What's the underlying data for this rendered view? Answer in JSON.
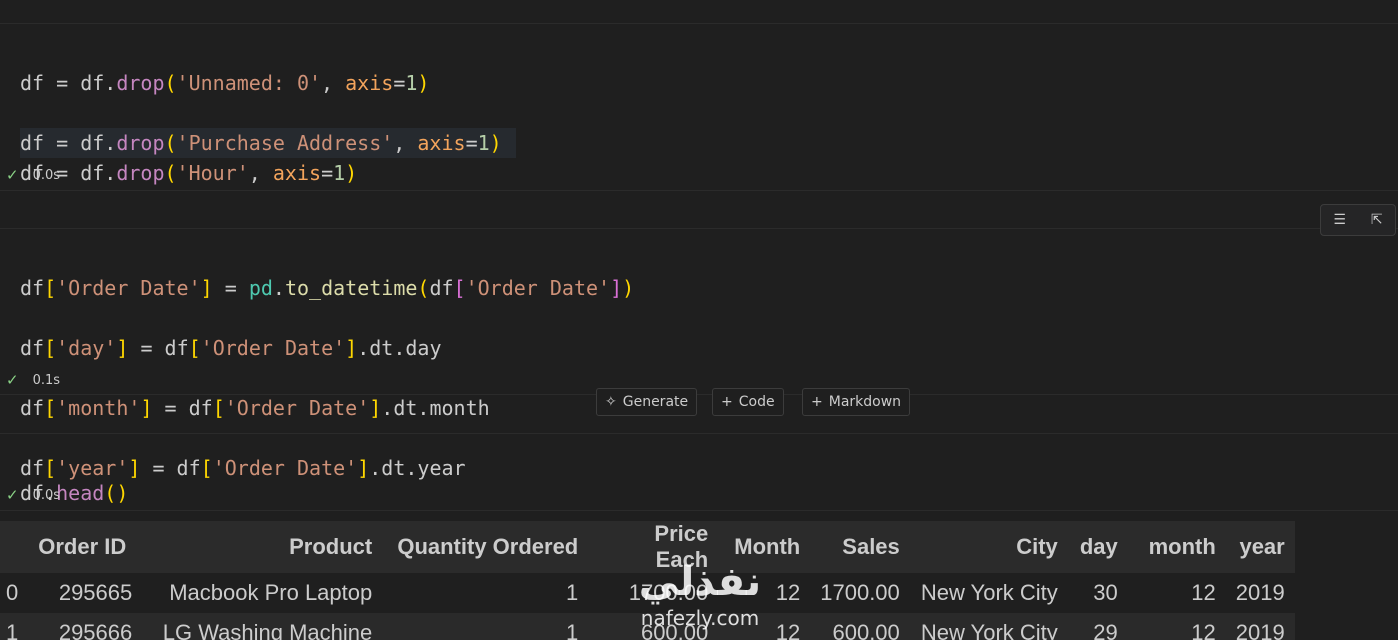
{
  "cell1": {
    "status_time": "0.0s"
  },
  "cell2": {
    "status_time": "0.1s"
  },
  "cell3": {
    "code": "df.head()",
    "status_time": "0.0s"
  },
  "add_bar": {
    "generate": "Generate",
    "code": "Code",
    "markdown": "Markdown"
  },
  "table": {
    "columns": [
      "",
      "Order ID",
      "Product",
      "Quantity Ordered",
      "Price Each",
      "Month",
      "Sales",
      "City",
      "day",
      "month",
      "year"
    ],
    "rows": [
      [
        "0",
        "295665",
        "Macbook Pro Laptop",
        "1",
        "1700.00",
        "12",
        "1700.00",
        "New York City",
        "30",
        "12",
        "2019"
      ],
      [
        "1",
        "295666",
        "LG Washing Machine",
        "1",
        "600.00",
        "12",
        "600.00",
        "New York City",
        "29",
        "12",
        "2019"
      ]
    ]
  },
  "watermark": {
    "line1": "نفذلي",
    "line2": "nafezly.com"
  }
}
